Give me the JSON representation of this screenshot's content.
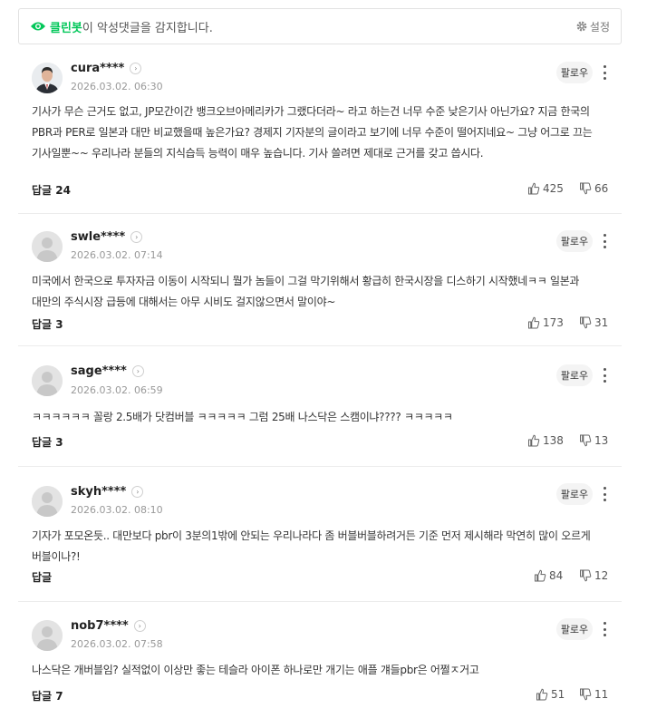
{
  "banner": {
    "brand": "클린봇",
    "message": "이 악성댓글을 감지합니다.",
    "settings_label": "설정"
  },
  "comments": [
    {
      "author": "cura****",
      "date": "2026.03.02. 06:30",
      "follow_label": "팔로우",
      "text": "기사가 무슨 근거도 없고, JP모간이간 뱅크오브아메리카가 그랬다더라~ 라고 하는건 너무 수준 낮은기사 아닌가요? 지금 한국의 PBR과 PER로 일본과 대만 비교했을때 높은가요? 경제지 기자분의 글이라고 보기에 너무 수준이 떨어지네요~ 그냥 어그로 끄는 기사일뿐~~ 우리나라 분들의 지식습득 능력이 매우 높습니다. 기사 쓸려면 제대로 근거를 갖고 씁시다.",
      "replies": "답글 24",
      "likes": "425",
      "dislikes": "66",
      "has_photo": true
    },
    {
      "author": "swle****",
      "date": "2026.03.02. 07:14",
      "follow_label": "팔로우",
      "text": "미국에서 한국으로 투자자금 이동이 시작되니 뭘가 놈들이 그걸 막기위해서 황급히 한국시장을 디스하기 시작했네ㅋㅋ 일본과 대만의 주식시장 급등에 대해서는 아무 시비도 걸지않으면서 말이야~",
      "replies": "답글 3",
      "likes": "173",
      "dislikes": "31",
      "has_photo": false
    },
    {
      "author": "sage****",
      "date": "2026.03.02. 06:59",
      "follow_label": "팔로우",
      "text": "ㅋㅋㅋㅋㅋㅋ 꼴랑 2.5배가 닷컴버블 ㅋㅋㅋㅋㅋ 그럼 25배 나스닥은 스캠이냐???? ㅋㅋㅋㅋㅋ",
      "replies": "답글 3",
      "likes": "138",
      "dislikes": "13",
      "has_photo": false
    },
    {
      "author": "skyh****",
      "date": "2026.03.02. 08:10",
      "follow_label": "팔로우",
      "text": "기자가 포모온듯.. 대만보다 pbr이 3분의1밖에 안되는 우리나라다 좀 버블버블하려거든 기준 먼저 제시해라 막연히 많이 오르게 버블이나?!",
      "replies": "답글",
      "likes": "84",
      "dislikes": "12",
      "has_photo": false
    },
    {
      "author": "nob7****",
      "date": "2026.03.02. 07:58",
      "follow_label": "팔로우",
      "text": "나스닥은 개버블임? 실적없이 이상만 좋는 테슬라 아이폰 하나로만 개기는 애플 걔들pbr은 어쩔ㅈ거고",
      "replies": "답글 7",
      "likes": "51",
      "dislikes": "11",
      "has_photo": false
    }
  ]
}
